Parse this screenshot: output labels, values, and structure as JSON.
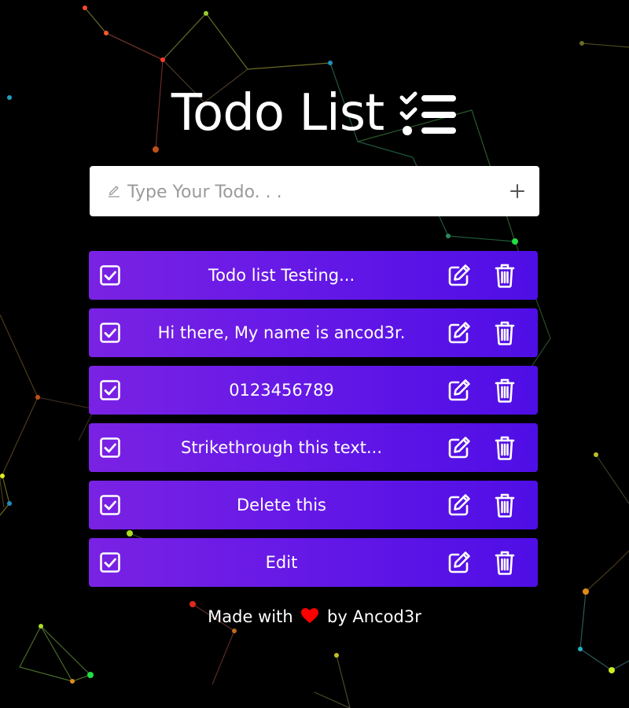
{
  "app": {
    "title": "Todo List"
  },
  "input": {
    "placeholder": "Type Your Todo. . .",
    "value": ""
  },
  "todos": [
    {
      "text": "Todo list Testing...",
      "checked": true
    },
    {
      "text": "Hi there, My name is ancod3r.",
      "checked": true
    },
    {
      "text": "0123456789",
      "checked": true
    },
    {
      "text": "Strikethrough this text...",
      "checked": true
    },
    {
      "text": "Delete this",
      "checked": true
    },
    {
      "text": "Edit",
      "checked": true
    }
  ],
  "footer": {
    "prefix": "Made with",
    "suffix": "by Ancod3r"
  },
  "colors": {
    "background": "#000000",
    "item_gradient_start": "#7a22e4",
    "item_gradient_end": "#4f0ee6",
    "heart": "#ff0000"
  },
  "icons": [
    "checklist-icon",
    "pen-icon",
    "plus-icon",
    "checkbox-icon",
    "edit-icon",
    "trash-icon",
    "heart-icon"
  ]
}
